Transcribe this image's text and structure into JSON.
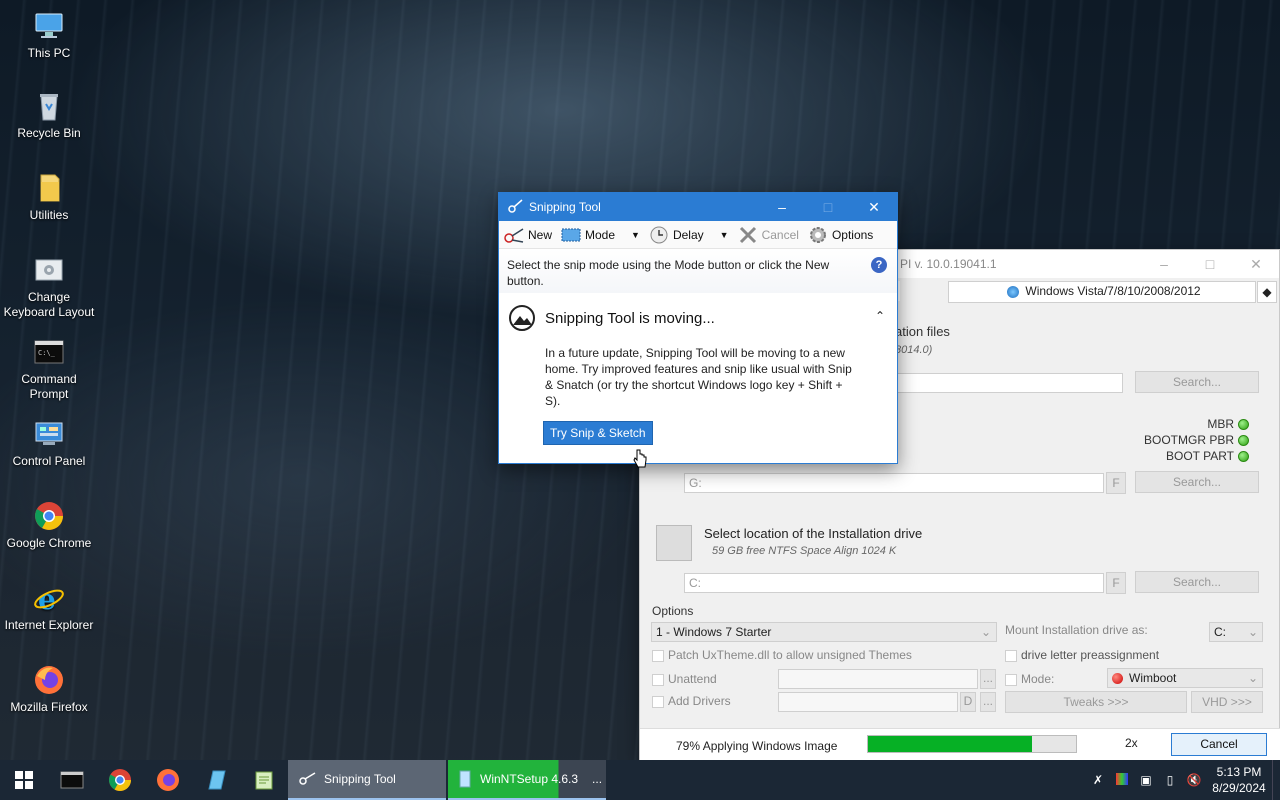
{
  "desktop": {
    "icons": [
      {
        "label": "This PC"
      },
      {
        "label": "Recycle Bin"
      },
      {
        "label": "Utilities"
      },
      {
        "label": "Change Keyboard Layout"
      },
      {
        "label": "Command Prompt"
      },
      {
        "label": "Control Panel"
      },
      {
        "label": "Google Chrome"
      },
      {
        "label": "Internet Explorer"
      },
      {
        "label": "Mozilla Firefox"
      }
    ]
  },
  "snipping_tool": {
    "title": "Snipping Tool",
    "toolbar": {
      "new": "New",
      "mode": "Mode",
      "delay": "Delay",
      "cancel": "Cancel",
      "options": "Options"
    },
    "hint": "Select the snip mode using the Mode button or click the New button.",
    "notice": {
      "title": "Snipping Tool is moving...",
      "body": "In a future update, Snipping Tool will be moving to a new home. Try improved features and snip like usual with Snip & Snatch (or try the shortcut Windows logo key + Shift + S).",
      "button": "Try Snip & Sketch"
    }
  },
  "winntsetup": {
    "title_fragment": "PI v. 10.0.19041.1",
    "os_select": "Windows Vista/7/8/10/2008/2012",
    "install_files": {
      "title_fragment": "ation files",
      "sub_fragment": "8014.0)",
      "search": "Search..."
    },
    "boot": {
      "mbr": "MBR",
      "bootmgr": "BOOTMGR PBR",
      "bootpart": "BOOT PART",
      "drive": "G:",
      "f": "F",
      "search": "Search..."
    },
    "install_drive": {
      "title": "Select location of the Installation drive",
      "sub": "59 GB free NTFS Space Align 1024 K",
      "drive": "C:",
      "f": "F",
      "search": "Search..."
    },
    "options": {
      "label": "Options",
      "edition": "1 - Windows 7 Starter",
      "mount_label": "Mount Installation drive as:",
      "mount_value": "C:",
      "patch": "Patch UxTheme.dll to allow unsigned Themes",
      "preassign": "drive letter preassignment",
      "unattend": "Unattend",
      "mode": "Mode:",
      "mode_value": "Wimboot",
      "add_drivers": "Add Drivers",
      "d": "D",
      "dots": "...",
      "tweaks": "Tweaks >>>",
      "vhd": "VHD >>>"
    },
    "status": {
      "text": "79% Applying Windows Image",
      "progress": 0.79,
      "speed": "2x",
      "cancel": "Cancel"
    }
  },
  "taskbar": {
    "tasks": [
      {
        "label": "Snipping Tool"
      },
      {
        "label": "WinNTSetup 4.6.3"
      }
    ],
    "more": "...",
    "time": "5:13 PM",
    "date": "8/29/2024"
  },
  "colors": {
    "accent": "#2b7cd3",
    "progress": "#06b025",
    "taskbar": "#1b2735"
  }
}
